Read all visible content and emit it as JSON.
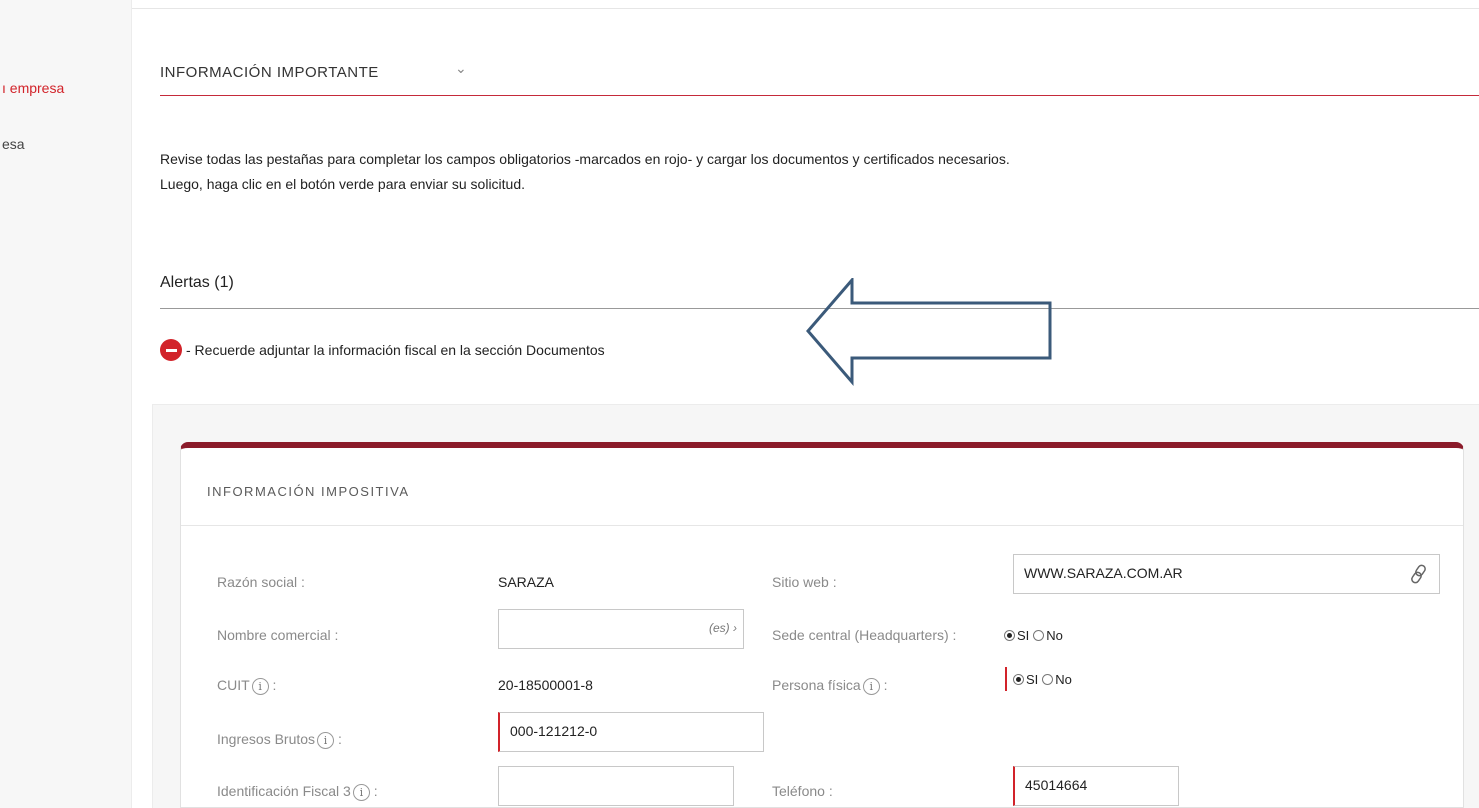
{
  "sidebar": {
    "items": [
      {
        "label": "ı empresa"
      },
      {
        "label": "esa"
      }
    ]
  },
  "section": {
    "title": "INFORMACIÓN IMPORTANTE",
    "toggle_glyph": "⌄"
  },
  "intro": {
    "line1": "Revise todas las pestañas para completar los campos obligatorios -marcados en rojo- y cargar los documentos y certificados necesarios.",
    "line2": "Luego, haga clic en el botón verde para enviar su solicitud."
  },
  "alerts": {
    "title": "Alertas (1)",
    "items": [
      {
        "text": "- Recuerde adjuntar la información fiscal en la sección Documentos"
      }
    ]
  },
  "colors": {
    "accent_red": "#d2232a",
    "card_top": "#8b1b2a",
    "arrow": "#3b5a7a"
  },
  "card": {
    "title": "INFORMACIÓN IMPOSITIVA",
    "razon_social": {
      "label": "Razón social :",
      "value": "SARAZA"
    },
    "nombre_comercial": {
      "label": "Nombre comercial :",
      "value": "",
      "lang": "(es) ›"
    },
    "cuit": {
      "label": "CUIT",
      "info": "i",
      "suffix": " :",
      "value": "20-18500001-8"
    },
    "ingresos_brutos": {
      "label": "Ingresos Brutos",
      "info": "i",
      "suffix": " :",
      "value": "000-121212-0"
    },
    "id_fiscal_3": {
      "label": "Identificación Fiscal 3",
      "info": "i",
      "suffix": " :",
      "value": ""
    },
    "sitio_web": {
      "label": "Sitio web :",
      "value": "WWW.SARAZA.COM.AR"
    },
    "sede_central": {
      "label": "Sede central (Headquarters) :",
      "yes": "SI",
      "no": "No"
    },
    "persona_fisica": {
      "label": "Persona física",
      "info": "i",
      "suffix": " :",
      "yes": "SI",
      "no": "No"
    },
    "telefono": {
      "label": "Teléfono :",
      "value": "45014664"
    }
  }
}
